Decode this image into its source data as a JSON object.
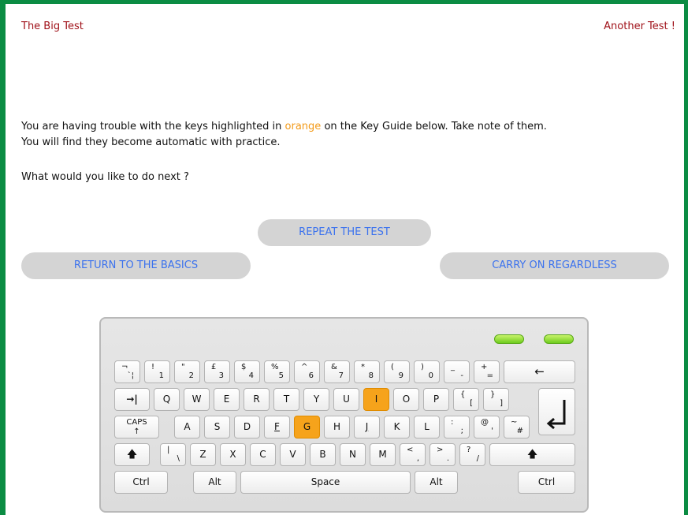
{
  "links": {
    "left": "The Big Test",
    "right": "Another Test !"
  },
  "message": {
    "part1": "You are having trouble with the keys highlighted in ",
    "highlight_word": "orange",
    "part2": " on the Key Guide below. Take note of them.",
    "line2": "You will find they become automatic with practice.",
    "highlight_color": "#f39a18"
  },
  "question": "What would you like to do next ?",
  "buttons": {
    "repeat": "REPEAT THE TEST",
    "basics": "RETURN TO THE BASICS",
    "carry": "CARRY ON REGARDLESS"
  },
  "keyboard": {
    "highlighted_keys": [
      "I",
      "G"
    ],
    "highlight_color": "#f6a31b",
    "row1": [
      {
        "top": "¬",
        "bottom": "`¦"
      },
      {
        "top": "!",
        "bottom": "1"
      },
      {
        "top": "\"",
        "bottom": "2"
      },
      {
        "top": "£",
        "bottom": "3"
      },
      {
        "top": "$",
        "bottom": "4"
      },
      {
        "top": "%",
        "bottom": "5"
      },
      {
        "top": "^",
        "bottom": "6"
      },
      {
        "top": "&",
        "bottom": "7"
      },
      {
        "top": "*",
        "bottom": "8"
      },
      {
        "top": "(",
        "bottom": "9"
      },
      {
        "top": ")",
        "bottom": "0"
      },
      {
        "top": "_",
        "bottom": "-"
      },
      {
        "top": "+",
        "bottom": "="
      }
    ],
    "backspace": "←",
    "tab": "→|",
    "row2": [
      "Q",
      "W",
      "E",
      "R",
      "T",
      "Y",
      "U",
      "I",
      "O",
      "P"
    ],
    "row2_extra": [
      {
        "top": "{",
        "bottom": "["
      },
      {
        "top": "}",
        "bottom": "]"
      }
    ],
    "caps_label": "CAPS",
    "caps_arrow": "↑",
    "row3": [
      "A",
      "S",
      "D",
      "F",
      "G",
      "H",
      "J",
      "K",
      "L"
    ],
    "row3_extra": [
      {
        "top": ":",
        "bottom": ";"
      },
      {
        "top": "@",
        "bottom": "'"
      },
      {
        "top": "~",
        "bottom": "#"
      }
    ],
    "shift_symbol": "🡅",
    "row4_pipe": {
      "top": "|",
      "bottom": "\\"
    },
    "row4": [
      "Z",
      "X",
      "C",
      "V",
      "B",
      "N",
      "M"
    ],
    "row4_extra": [
      {
        "top": "<",
        "bottom": ","
      },
      {
        "top": ">",
        "bottom": "."
      },
      {
        "top": "?",
        "bottom": "/"
      }
    ],
    "ctrl": "Ctrl",
    "alt": "Alt",
    "space": "Space",
    "enter_symbol": "↵"
  }
}
